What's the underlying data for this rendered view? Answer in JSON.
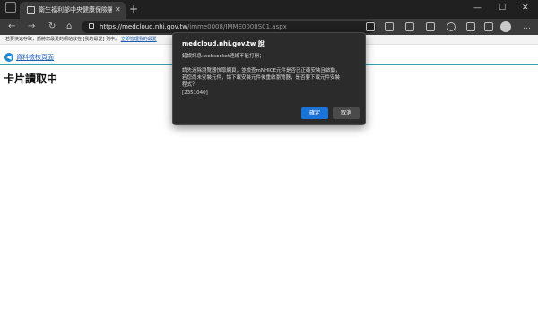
{
  "browser": {
    "tab": {
      "title": "衛生福利部中央健康保險署"
    },
    "new_tab_label": "+",
    "window_controls": {
      "minimize": "—",
      "maximize": "☐",
      "close": "✕"
    },
    "nav": {
      "back": "←",
      "forward": "→",
      "refresh": "↻",
      "home": "⌂"
    },
    "address": {
      "host": "https://medcloud.nhi.gov.tw",
      "path": "/imme0008/IMME0008S01.aspx"
    },
    "toolbar_icons": [
      "read-aloud-icon",
      "favorite-star-icon",
      "split-screen-icon",
      "favorites-icon",
      "history-icon",
      "collections-icon",
      "extensions-icon",
      "profile-icon",
      "more-icon"
    ],
    "more_label": "…",
    "favorites_bar": {
      "text": "若要快速存取，請將您最愛的網站放在 [我的最愛] 列中。",
      "link": "立即管理我的最愛"
    }
  },
  "page": {
    "back_link": "資料檢核頁面",
    "heading": "卡片讀取中"
  },
  "dialog": {
    "title": "medcloud.nhi.gov.tw 說",
    "lines": [
      "錯誤訊息:websocket連線不能打開；",
      "",
      "請先遠除瀏覽器快取網頁，並檢查mNHICE元件是否已正確安裝且啟動，",
      "若您尚未安裝元件，請下載安裝元件後重啟瀏覽器，是否要下載元件安裝",
      "程式？",
      "[2351040]"
    ],
    "ok_label": "確定",
    "cancel_label": "取消"
  },
  "colors": {
    "accent": "#1a73d9",
    "teal_rule": "#3aa0b0",
    "link": "#1a5fb4"
  }
}
